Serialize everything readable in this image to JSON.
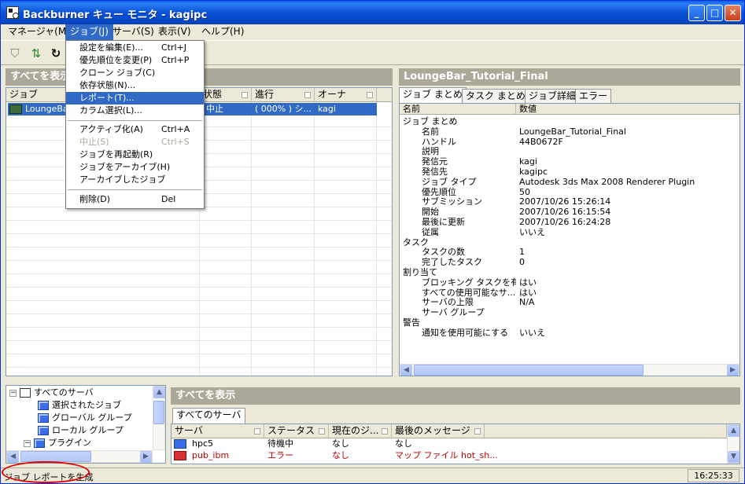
{
  "window": {
    "title": "Backburner キュー モニタ - kagipc",
    "buttons": {
      "minimize": "_",
      "maximize": "□",
      "close": "✕"
    }
  },
  "menubar": {
    "items": [
      {
        "label": "マネージャ(M)"
      },
      {
        "label": "ジョブ(J)"
      },
      {
        "label": "サーバ(S)"
      },
      {
        "label": "表示(V)"
      },
      {
        "label": "ヘルプ(H)"
      }
    ]
  },
  "toolbar": {
    "icons": [
      "filter-icon",
      "sort-icon",
      "refresh-icon"
    ]
  },
  "job_menu": {
    "items": [
      {
        "label": "設定を編集(E)...",
        "shortcut": "Ctrl+J"
      },
      {
        "label": "優先順位を変更(P)",
        "shortcut": "Ctrl+P"
      },
      {
        "label": "クローン ジョブ(C)",
        "shortcut": ""
      },
      {
        "label": "依存状態(N)...",
        "shortcut": ""
      },
      {
        "label": "レポート(T)...",
        "shortcut": ""
      },
      {
        "label": "カラム選択(L)...",
        "shortcut": ""
      },
      {
        "label": "アクティブ化(A)",
        "shortcut": "Ctrl+A"
      },
      {
        "label": "中止(S)",
        "shortcut": "Ctrl+S"
      },
      {
        "label": "ジョブを再起動(R)",
        "shortcut": ""
      },
      {
        "label": "ジョブをアーカイブ(H)",
        "shortcut": ""
      },
      {
        "label": "アーカイブしたジョブ",
        "shortcut": ""
      },
      {
        "label": "削除(D)",
        "shortcut": "Del"
      }
    ]
  },
  "jobs_panel": {
    "header": "すべてを表示",
    "columns": [
      "ジョブ",
      "状態",
      "進行",
      "オーナ"
    ],
    "row": {
      "job": "LoungeBar",
      "state": "中止",
      "progress": "( 000% ) シ...",
      "owner": "kagi"
    }
  },
  "details": {
    "header": "LoungeBar_Tutorial_Final",
    "tabs": [
      "ジョブ まとめ",
      "タスク まとめ",
      "ジョブ詳細",
      "エラー"
    ],
    "columns": [
      "名前",
      "数値"
    ],
    "rows": [
      {
        "k": "ジョブ まとめ",
        "v": "",
        "type": "group"
      },
      {
        "k": "名前",
        "v": "LoungeBar_Tutorial_Final",
        "type": "child"
      },
      {
        "k": "ハンドル",
        "v": "44B0672F",
        "type": "child"
      },
      {
        "k": "説明",
        "v": "",
        "type": "child"
      },
      {
        "k": "発信元",
        "v": "kagi",
        "type": "child"
      },
      {
        "k": "発信先",
        "v": "kagipc",
        "type": "child"
      },
      {
        "k": "ジョブ タイプ",
        "v": "Autodesk 3ds Max 2008 Renderer Plugin",
        "type": "child"
      },
      {
        "k": "優先順位",
        "v": "50",
        "type": "child"
      },
      {
        "k": "サブミッション",
        "v": "2007/10/26 15:26:14",
        "type": "child"
      },
      {
        "k": "開始",
        "v": "2007/10/26 16:15:54",
        "type": "child"
      },
      {
        "k": "最後に更新",
        "v": "2007/10/26 16:24:28",
        "type": "child"
      },
      {
        "k": "従属",
        "v": "いいえ",
        "type": "child"
      },
      {
        "k": "タスク",
        "v": "",
        "type": "group"
      },
      {
        "k": "タスクの数",
        "v": "1",
        "type": "child"
      },
      {
        "k": "完了したタスク",
        "v": "0",
        "type": "child"
      },
      {
        "k": "割り当て",
        "v": "",
        "type": "group"
      },
      {
        "k": "ブロッキング タスクを有効",
        "v": "はい",
        "type": "child"
      },
      {
        "k": "すべての使用可能なサ...",
        "v": "はい",
        "type": "child"
      },
      {
        "k": "サーバの上限",
        "v": "N/A",
        "type": "child"
      },
      {
        "k": "サーバ グループ",
        "v": "",
        "type": "child"
      },
      {
        "k": "警告",
        "v": "",
        "type": "group"
      },
      {
        "k": "通知を使用可能にする",
        "v": "いいえ",
        "type": "child"
      }
    ]
  },
  "server_tree": {
    "items": [
      {
        "label": "すべてのサーバ"
      },
      {
        "label": "選択されたジョブ"
      },
      {
        "label": "グローバル グループ"
      },
      {
        "label": "ローカル グループ"
      },
      {
        "label": "プラグイン"
      }
    ]
  },
  "servers_panel": {
    "header": "すべてを表示",
    "tab": "すべてのサーバ",
    "columns": [
      "サーバ",
      "ステータス",
      "現在のジ...",
      "最後のメッセージ"
    ],
    "rows": [
      {
        "server": "hpc5",
        "status": "待機中",
        "current": "なし",
        "message": "なし",
        "error": false
      },
      {
        "server": "pub_ibm",
        "status": "エラー",
        "current": "なし",
        "message": "マップ ファイル hot_sh...",
        "error": true
      }
    ]
  },
  "statusbar": {
    "text": "ジョブ レポートを生成",
    "time": "16:25:33"
  },
  "colors": {
    "accent": "#316ac5",
    "error": "#c00000",
    "annotation": "#e00000"
  }
}
